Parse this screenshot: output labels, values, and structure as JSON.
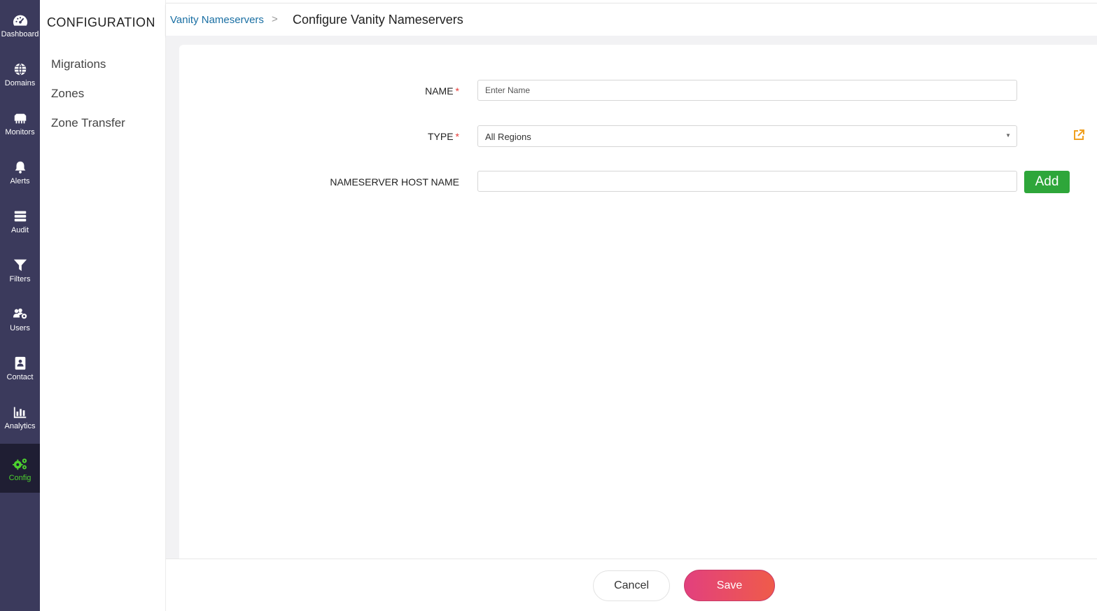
{
  "rail": {
    "items": [
      {
        "label": "Dashboard",
        "icon": "dashboard-icon"
      },
      {
        "label": "Domains",
        "icon": "globe-icon"
      },
      {
        "label": "Monitors",
        "icon": "network-icon"
      },
      {
        "label": "Alerts",
        "icon": "bell-icon"
      },
      {
        "label": "Audit",
        "icon": "list-icon"
      },
      {
        "label": "Filters",
        "icon": "funnel-icon"
      },
      {
        "label": "Users",
        "icon": "users-gear-icon"
      },
      {
        "label": "Contact",
        "icon": "contact-icon"
      },
      {
        "label": "Analytics",
        "icon": "bar-chart-icon"
      },
      {
        "label": "Config",
        "icon": "cogs-icon",
        "active": true
      }
    ],
    "active_color": "#4cd12f"
  },
  "subnav": {
    "title": "CONFIGURATION",
    "items": [
      {
        "label": "Migrations"
      },
      {
        "label": "Zones"
      },
      {
        "label": "Zone Transfer"
      }
    ]
  },
  "breadcrumb": {
    "parent": "Vanity Nameservers",
    "separator": ">",
    "current": "Configure Vanity Nameservers"
  },
  "form": {
    "name": {
      "label": "NAME",
      "required_mark": "*",
      "placeholder": "Enter Name",
      "value": ""
    },
    "type": {
      "label": "TYPE",
      "required_mark": "*",
      "selected": "All Regions"
    },
    "host": {
      "label": "NAMESERVER HOST NAME",
      "value": "",
      "add_label": "Add"
    }
  },
  "footer": {
    "cancel_label": "Cancel",
    "save_label": "Save"
  },
  "colors": {
    "rail_bg": "#3b3a5c",
    "link": "#1a6fa3",
    "add_button": "#2ea63a",
    "save_gradient_start": "#e2407e",
    "save_gradient_end": "#ef5b4a",
    "external_link": "#f0a020"
  }
}
